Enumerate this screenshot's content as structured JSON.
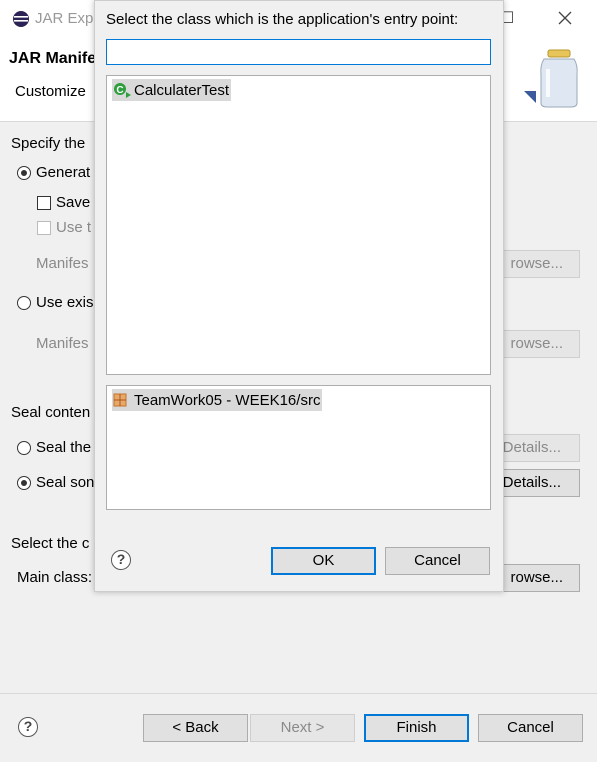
{
  "window": {
    "title": "JAR Expo",
    "header_title": "JAR Manife",
    "header_subtitle": "Customize",
    "close_glyph": "☐"
  },
  "manifest_section": {
    "label": "Specify the",
    "generate_radio": "Generat",
    "save_checkbox": "Save",
    "use_checkbox": "Use t",
    "manifest_label_1": "Manifes",
    "browse_1": "rowse...",
    "use_existing_radio": "Use exis",
    "manifest_label_2": "Manifes",
    "browse_2": "rowse..."
  },
  "seal_section": {
    "label": "Seal conten",
    "seal_the_radio": "Seal the",
    "details_1": "Details...",
    "seal_some_radio": "Seal son",
    "details_2": "Details..."
  },
  "main_class_section": {
    "label": "Select the c",
    "main_class_label": "Main class:",
    "browse_3": "rowse..."
  },
  "footer": {
    "help": "?",
    "back": "< Back",
    "next": "Next >",
    "finish": "Finish",
    "cancel": "Cancel"
  },
  "dialog": {
    "prompt": "Select the class which is the application's entry point:",
    "filter_value": "",
    "classes": [
      {
        "name": "CalculaterTest",
        "icon": "class-icon"
      }
    ],
    "packages": [
      {
        "name": "TeamWork05 - WEEK16/src",
        "icon": "package-icon"
      }
    ],
    "help": "?",
    "ok": "OK",
    "cancel": "Cancel"
  },
  "colors": {
    "accent": "#0078d7",
    "selection": "#d9d9d9",
    "class_icon": "#2e9e3e",
    "package_icon": "#c8742c"
  }
}
